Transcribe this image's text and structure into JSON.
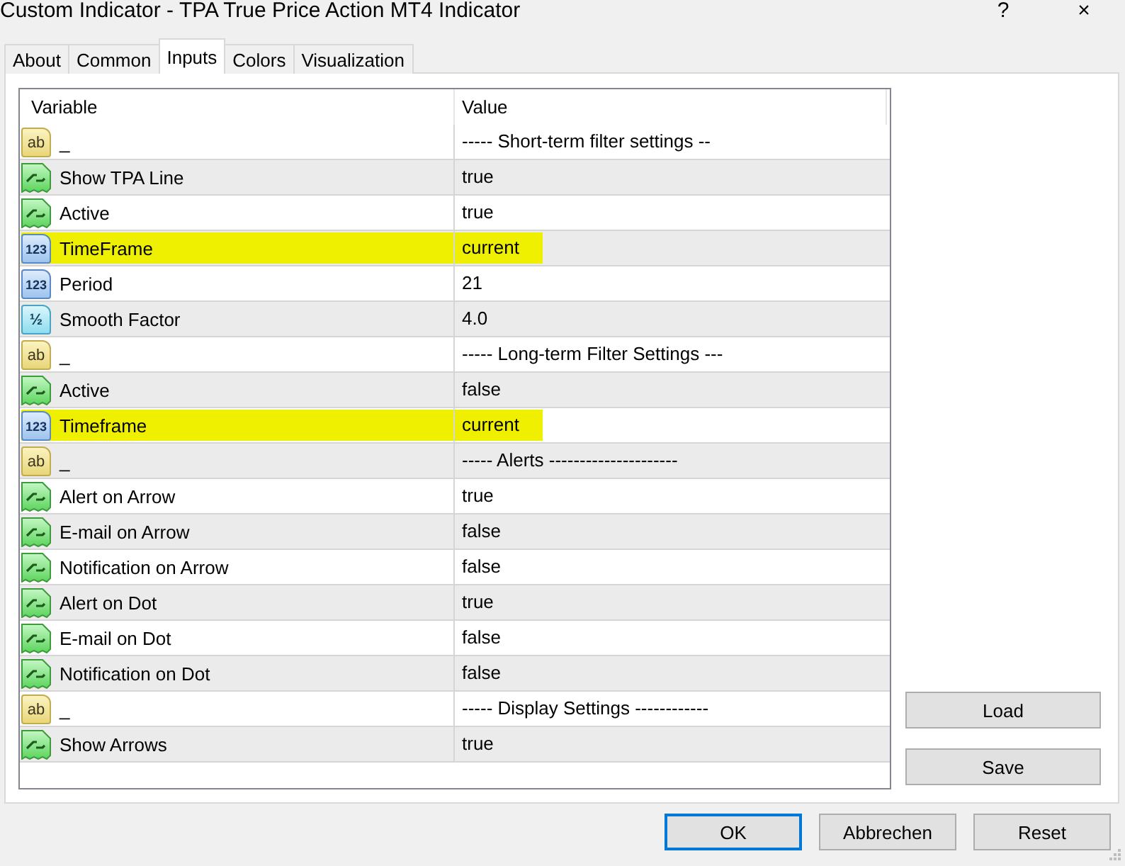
{
  "window": {
    "title": "Custom Indicator - TPA True Price Action MT4 Indicator",
    "help": "?",
    "close": "×"
  },
  "tabs": [
    {
      "label": "About",
      "selected": false
    },
    {
      "label": "Common",
      "selected": false
    },
    {
      "label": "Inputs",
      "selected": true
    },
    {
      "label": "Colors",
      "selected": false
    },
    {
      "label": "Visualization",
      "selected": false
    }
  ],
  "table": {
    "columns": [
      "Variable",
      "Value"
    ],
    "rows": [
      {
        "kind": "string",
        "badge": "ab",
        "variable": "_",
        "value": "----- Short-term filter settings --",
        "highlighted": false
      },
      {
        "kind": "bool",
        "variable": "Show TPA Line",
        "value": "true",
        "highlighted": false
      },
      {
        "kind": "bool",
        "variable": "Active",
        "value": "true",
        "highlighted": false
      },
      {
        "kind": "int",
        "badge": "123",
        "variable": "TimeFrame",
        "value": "current",
        "highlighted": true
      },
      {
        "kind": "int",
        "badge": "123",
        "variable": "Period",
        "value": "21",
        "highlighted": false
      },
      {
        "kind": "double",
        "badge": "½",
        "variable": "Smooth Factor",
        "value": "4.0",
        "highlighted": false
      },
      {
        "kind": "string",
        "badge": "ab",
        "variable": "_",
        "value": "----- Long-term Filter Settings ---",
        "highlighted": false
      },
      {
        "kind": "bool",
        "variable": "Active",
        "value": "false",
        "highlighted": false
      },
      {
        "kind": "int",
        "badge": "123",
        "variable": "Timeframe",
        "value": "current",
        "highlighted": true
      },
      {
        "kind": "string",
        "badge": "ab",
        "variable": "_",
        "value": "----- Alerts ---------------------",
        "highlighted": false
      },
      {
        "kind": "bool",
        "variable": "Alert on Arrow",
        "value": "true",
        "highlighted": false
      },
      {
        "kind": "bool",
        "variable": "E-mail on Arrow",
        "value": "false",
        "highlighted": false
      },
      {
        "kind": "bool",
        "variable": "Notification on Arrow",
        "value": "false",
        "highlighted": false
      },
      {
        "kind": "bool",
        "variable": "Alert on Dot",
        "value": "true",
        "highlighted": false
      },
      {
        "kind": "bool",
        "variable": "E-mail on Dot",
        "value": "false",
        "highlighted": false
      },
      {
        "kind": "bool",
        "variable": "Notification on Dot",
        "value": "false",
        "highlighted": false
      },
      {
        "kind": "string",
        "badge": "ab",
        "variable": "_",
        "value": "----- Display Settings ------------",
        "highlighted": false
      },
      {
        "kind": "bool",
        "variable": "Show Arrows",
        "value": "true",
        "highlighted": false
      }
    ]
  },
  "side_buttons": [
    "Load",
    "Save"
  ],
  "buttons": [
    {
      "label": "OK",
      "focused": true
    },
    {
      "label": "Abbrechen",
      "focused": false
    },
    {
      "label": "Reset",
      "focused": false
    }
  ]
}
